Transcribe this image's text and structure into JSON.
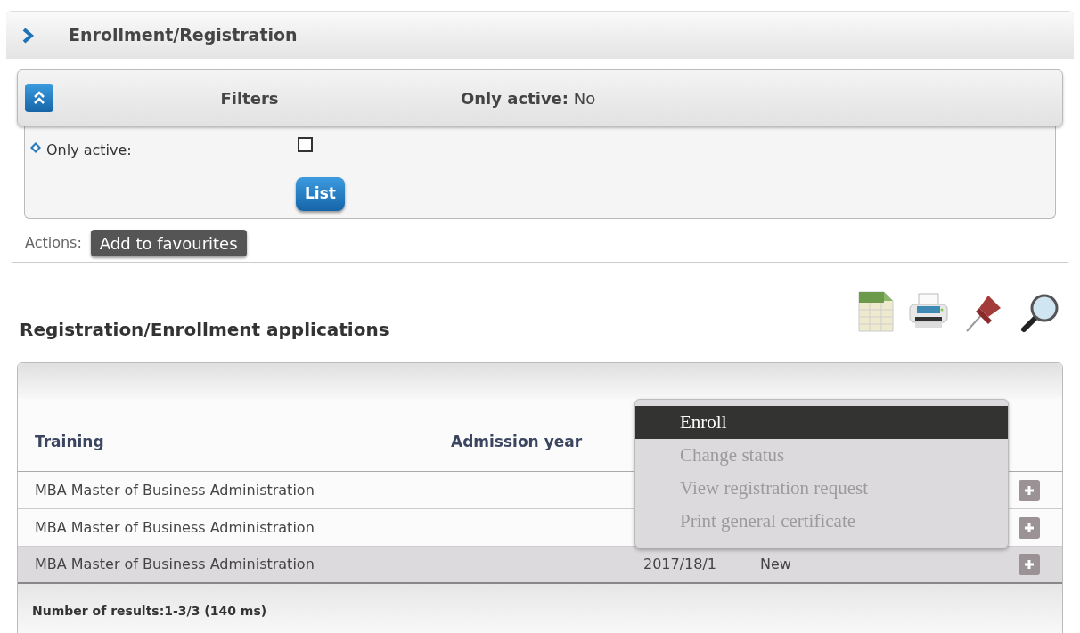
{
  "page_title": "Enrollment/Registration",
  "filters": {
    "title": "Filters",
    "summary_label": "Only active:",
    "summary_value": "No",
    "expanded": true,
    "fields": [
      {
        "label": "Only active:",
        "checked": false
      }
    ],
    "submit": "List"
  },
  "actions": {
    "label": "Actions:",
    "buttons": [
      "Add to favourites"
    ]
  },
  "results": {
    "title": "Registration/Enrollment applications",
    "columns": [
      "Training",
      "Admission year"
    ],
    "rows": [
      {
        "training": "MBA Master of Business Administration",
        "selected": false
      },
      {
        "training": "MBA Master of Business Administration",
        "selected": false
      },
      {
        "training": "MBA Master of Business Administration",
        "admission_year": "2017/18/1",
        "status": "New",
        "selected": true
      }
    ],
    "footer": "Number of results:1-3/3 (140 ms)"
  },
  "context_menu": [
    {
      "label": "Enroll",
      "selected": true,
      "disabled": false
    },
    {
      "label": "Change status",
      "selected": false,
      "disabled": true
    },
    {
      "label": "View registration request",
      "selected": false,
      "disabled": true
    },
    {
      "label": "Print general certificate",
      "selected": false,
      "disabled": true
    }
  ]
}
